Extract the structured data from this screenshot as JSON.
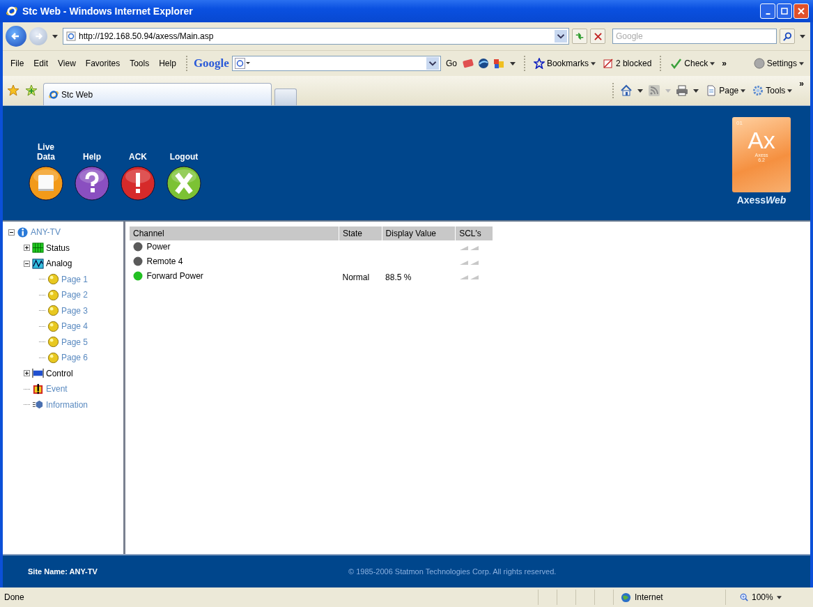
{
  "window": {
    "title": "Stc Web - Windows Internet Explorer"
  },
  "address_bar": {
    "url": "http://192.168.50.94/axess/Main.asp"
  },
  "search": {
    "placeholder": "Google"
  },
  "menu": [
    "File",
    "Edit",
    "View",
    "Favorites",
    "Tools",
    "Help"
  ],
  "google_toolbar": {
    "brand": "Google",
    "go": "Go",
    "bookmarks": "Bookmarks",
    "blocked": "2 blocked",
    "check": "Check",
    "more": "»",
    "settings": "Settings"
  },
  "tabs": [
    {
      "label": "Stc Web",
      "selected": true
    }
  ],
  "command_bar": {
    "page": "Page",
    "tools": "Tools",
    "more": "»"
  },
  "banner": {
    "actions": [
      {
        "label": "Live Data",
        "kind": "live"
      },
      {
        "label": "Help",
        "kind": "help"
      },
      {
        "label": "ACK",
        "kind": "ack"
      },
      {
        "label": "Logout",
        "kind": "logout"
      }
    ],
    "logo": {
      "number": "01",
      "symbol": "Ax",
      "name": "Axess",
      "version": "6.2",
      "caption": [
        {
          "text": "Axess",
          "italic": false
        },
        {
          "text": "Web",
          "italic": true
        }
      ]
    }
  },
  "tree": {
    "label": "ANY-TV",
    "kind": "site",
    "expanded": true,
    "children": [
      {
        "label": "Status",
        "kind": "status",
        "expanded": false
      },
      {
        "label": "Analog",
        "kind": "analog",
        "expanded": true,
        "children": [
          {
            "label": "Page 1",
            "kind": "page"
          },
          {
            "label": "Page 2",
            "kind": "page"
          },
          {
            "label": "Page 3",
            "kind": "page"
          },
          {
            "label": "Page 4",
            "kind": "page"
          },
          {
            "label": "Page 5",
            "kind": "page"
          },
          {
            "label": "Page 6",
            "kind": "page"
          }
        ]
      },
      {
        "label": "Control",
        "kind": "control",
        "expanded": false
      },
      {
        "label": "Event",
        "kind": "event"
      },
      {
        "label": "Information",
        "kind": "info"
      }
    ]
  },
  "table": {
    "columns": [
      "Channel",
      "State",
      "Display Value",
      "SCL's"
    ],
    "rows": [
      {
        "channel": "Power",
        "color": "#5a5a5a"
      },
      {
        "channel": "Remote 4",
        "color": "#5a5a5a"
      },
      {
        "channel": "Forward Power",
        "color": "#22c022",
        "state": "Normal",
        "value": "88.5 %"
      }
    ]
  },
  "footer": {
    "site": "Site Name: ANY-TV",
    "copyright": "© 1985-2006 Statmon Technologies Corp. All rights reserved."
  },
  "status_bar": {
    "text": "Done",
    "zone": "Internet",
    "zoom": "100%"
  }
}
